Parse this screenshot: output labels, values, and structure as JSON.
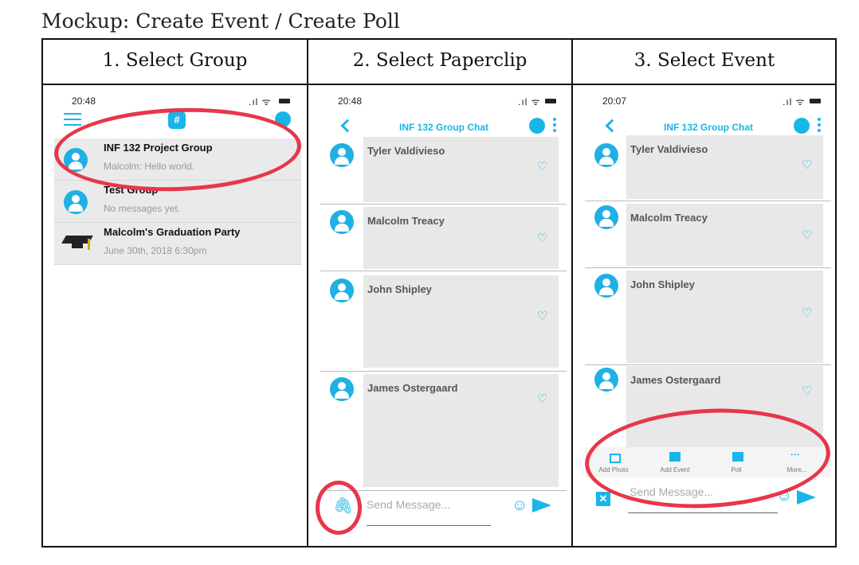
{
  "doc_title": "Mockup: Create Event / Create Poll",
  "steps": [
    "1.   Select Group",
    "2. Select Paperclip",
    "3. Select Event"
  ],
  "screen1": {
    "time": "20:48",
    "groups": [
      {
        "name": "INF 132 Project Group",
        "sub": "Malcolm: Hello world."
      },
      {
        "name": "Test Group",
        "sub": "No messages yet."
      },
      {
        "name": "Malcolm's Graduation Party",
        "sub": "June 30th, 2018 6:30pm"
      }
    ]
  },
  "screen2": {
    "time": "20:48",
    "chat_title": "INF 132 Group Chat",
    "members": [
      "Tyler Valdivieso",
      "Malcolm Treacy",
      "John Shipley",
      "James Ostergaard"
    ],
    "input_placeholder": "Send Message..."
  },
  "screen3": {
    "time": "20:07",
    "chat_title": "INF 132 Group Chat",
    "members": [
      "Tyler Valdivieso",
      "Malcolm Treacy",
      "John Shipley",
      "James Ostergaard"
    ],
    "tools": [
      "Add Photo",
      "Add Event",
      "Poll",
      "More..."
    ],
    "input_placeholder": "Send Message..."
  },
  "colors": {
    "accent": "#18b6e8",
    "highlight": "#e8364a",
    "card": "#e8e8e8"
  }
}
